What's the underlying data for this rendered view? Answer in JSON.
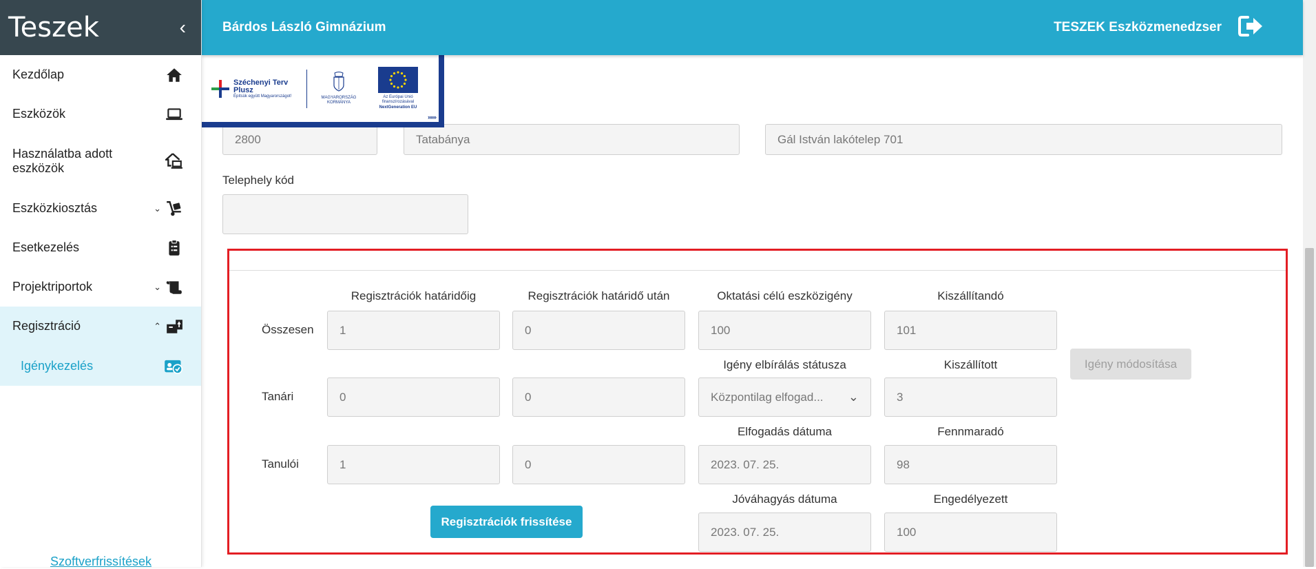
{
  "sidebar": {
    "title": "Teszek",
    "items": [
      {
        "label": "Kezdőlap"
      },
      {
        "label": "Eszközök"
      },
      {
        "label": "Használatba adott eszközök"
      },
      {
        "label": "Eszközkiosztás"
      },
      {
        "label": "Esetkezelés"
      },
      {
        "label": "Projektriportok"
      },
      {
        "label": "Regisztráció"
      }
    ],
    "sub_item": {
      "label": "Igénykezelés"
    },
    "software_updates": "Szoftverfrissítések"
  },
  "topbar": {
    "school": "Bárdos László Gimnázium",
    "app_name": "TESZEK Eszközmenedzser"
  },
  "logos": {
    "szechenyi_line1": "Széchenyi Terv",
    "szechenyi_line2": "Plusz",
    "szechenyi_tagline": "Építsük együtt Magyarországot!",
    "kormany": "MAGYARORSZÁG KORMÁNYA",
    "eu_line1": "Az Európai Unió",
    "eu_line2": "finanszírozásával",
    "eu_line3": "NextGeneration EU"
  },
  "address": {
    "zip": "2800",
    "city": "Tatabánya",
    "street": "Gál István lakótelep 701"
  },
  "site_code": {
    "label": "Telephely kód",
    "value": ""
  },
  "registration": {
    "col_headers": {
      "before_deadline": "Regisztrációk határidőig",
      "after_deadline": "Regisztrációk határidő után",
      "edu_demand": "Oktatási célú eszközigény",
      "to_deliver": "Kiszállítandó",
      "status": "Igény elbírálás státusza",
      "delivered": "Kiszállított",
      "accept_date": "Elfogadás dátuma",
      "remaining": "Fennmaradó",
      "approve_date": "Jóváhagyás dátuma",
      "approved": "Engedélyezett"
    },
    "row_labels": {
      "total": "Összesen",
      "teacher": "Tanári",
      "student": "Tanulói"
    },
    "values": {
      "total_before": "1",
      "total_after": "0",
      "edu_demand": "100",
      "to_deliver": "101",
      "teacher_before": "0",
      "teacher_after": "0",
      "status": "Központilag elfogad...",
      "delivered": "3",
      "student_before": "1",
      "student_after": "0",
      "accept_date": "2023. 07. 25.",
      "remaining": "98",
      "approve_date": "2023. 07. 25.",
      "approved": "100"
    },
    "refresh_button": "Regisztrációk frissítése",
    "modify_button": "Igény módosítása"
  },
  "colors": {
    "accent": "#25a9cd",
    "sidebar_header": "#37474f",
    "highlight": "#e31e24",
    "active_bg": "#e0f4fa"
  }
}
